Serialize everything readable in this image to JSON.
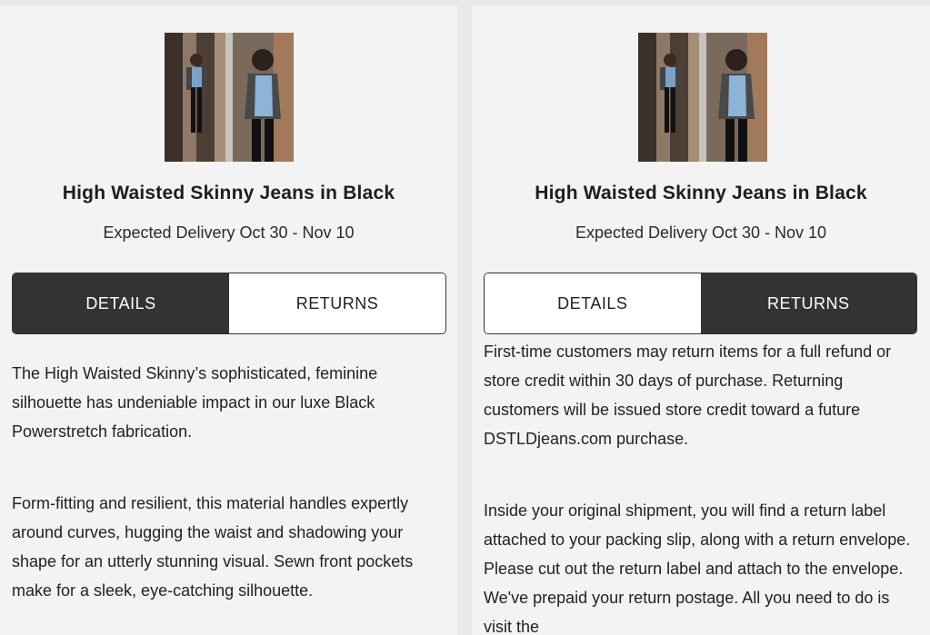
{
  "colors": {
    "accent_dark": "#333333",
    "background": "#f3f3f3"
  },
  "left": {
    "image_icon": "product-photo",
    "product_title": "High Waisted Skinny Jeans in Black",
    "delivery": "Expected Delivery Oct 30 - Nov 10",
    "tabs": [
      {
        "label": "DETAILS",
        "active": true
      },
      {
        "label": "RETURNS",
        "active": false
      }
    ],
    "paragraphs": [
      "The High Waisted Skinny’s sophisticated, feminine silhouette has undeniable impact in our luxe Black Powerstretch fabrication.",
      "Form-fitting and resilient, this material handles expertly around curves, hugging the waist and shadowing your shape for an utterly stunning visual. Sewn front pockets make for a sleek, eye-catching silhouette."
    ]
  },
  "right": {
    "image_icon": "product-photo",
    "product_title": "High Waisted Skinny Jeans in Black",
    "delivery": "Expected Delivery Oct 30 - Nov 10",
    "tabs": [
      {
        "label": "DETAILS",
        "active": false
      },
      {
        "label": "RETURNS",
        "active": true
      }
    ],
    "paragraphs": [
      "First-time customers may return items for a full refund or store credit within 30 days of purchase. Returning customers will be issued store credit toward a future DSTLDjeans.com purchase.",
      "Inside your original shipment, you will find a return label attached to your packing slip, along with a return envelope. Please cut out the return label and attach to the envelope. We've prepaid your return postage. All you need to do is visit the"
    ]
  }
}
